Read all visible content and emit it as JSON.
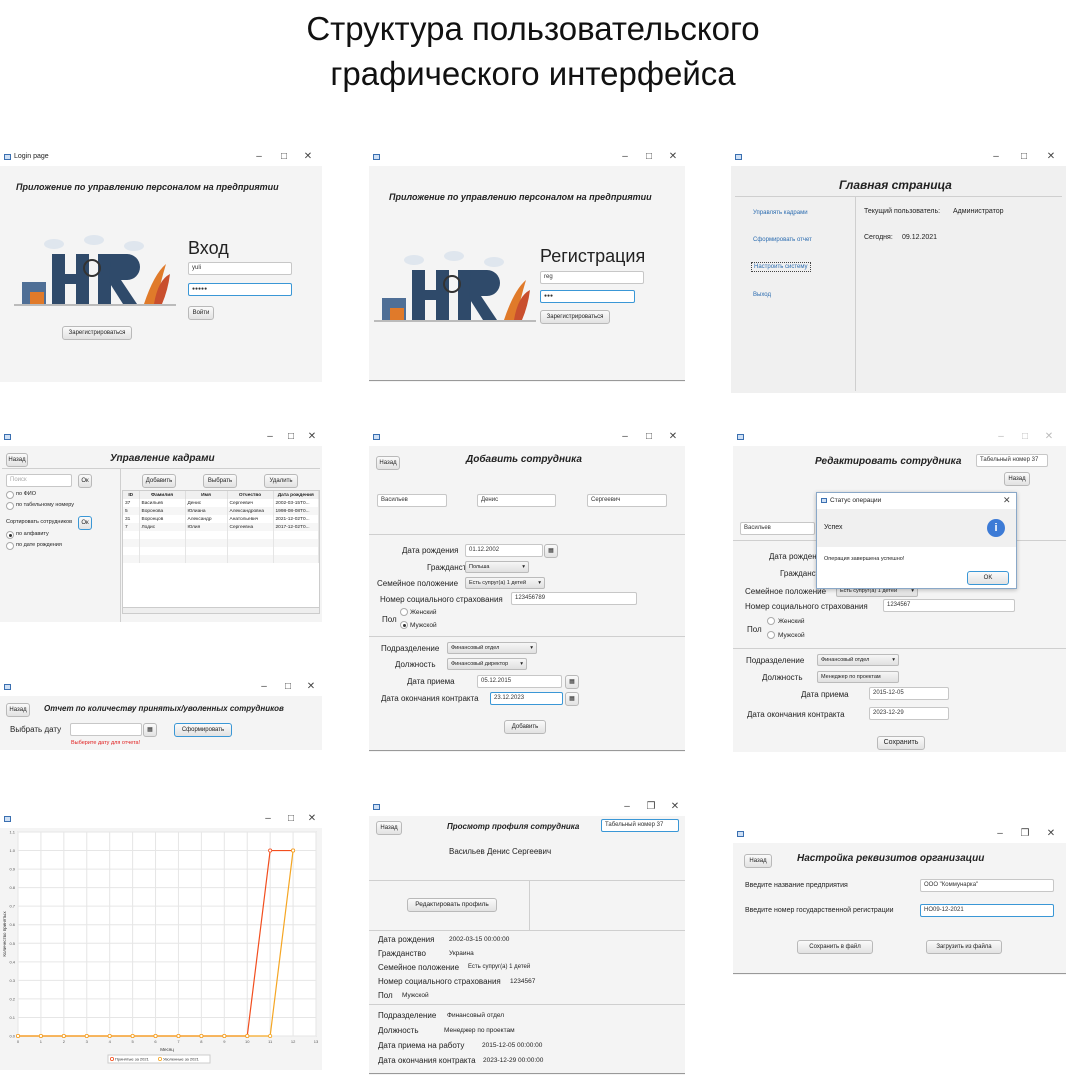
{
  "page_title_line1": "Структура пользовательского",
  "page_title_line2": "графического интерфейса",
  "win_controls": {
    "min": "–",
    "max": "□",
    "close": "✕",
    "restore": "❐"
  },
  "login": {
    "window_title": "Login page",
    "app_title": "Приложение по управлению персоналом на предприятии",
    "heading": "Вход",
    "username_value": "yuli",
    "password_value": "●●●●●",
    "login_button": "Войти",
    "register_button": "Зарегистрироваться"
  },
  "registration": {
    "app_title": "Приложение по управлению персоналом на предприятии",
    "heading": "Регистрация",
    "username_value": "reg",
    "password_value": "●●●",
    "register_button": "Зарегистрироваться"
  },
  "home": {
    "heading": "Главная страница",
    "menu": [
      "Управлять кадрами",
      "Сформировать отчет",
      "Настроить систему",
      "Выход"
    ],
    "current_user_label": "Текущий пользователь:",
    "current_user_value": "Администратор",
    "today_label": "Сегодня:",
    "today_value": "09.12.2021"
  },
  "personnel": {
    "heading": "Управление кадрами",
    "back_button": "Назад",
    "search_placeholder": "Поиск",
    "ok_button": "Ок",
    "search_by": [
      "по ФИО",
      "по табельному номеру"
    ],
    "sort_label": "Сортировать сотрудников",
    "sort_ok": "Ок",
    "sort_by": [
      "по алфавиту",
      "по дате рождения"
    ],
    "add_button": "Добавить",
    "select_button": "Выбрать",
    "delete_button": "Удалить",
    "columns": [
      "ID",
      "Фамилия",
      "Имя",
      "Отчество",
      "Дата рождения"
    ],
    "rows": [
      [
        "37",
        "Васильев",
        "Денис",
        "Сергеевич",
        "2002-03-15T0..."
      ],
      [
        "5",
        "Воронова",
        "Юлиана",
        "Александровна",
        "1998-08-08T0..."
      ],
      [
        "31",
        "Воронцов",
        "Александр",
        "Анатольевич",
        "2021-12-02T0..."
      ],
      [
        "7",
        "Лодис",
        "Юлия",
        "Сергеевна",
        "2017-12-02T0..."
      ]
    ]
  },
  "report": {
    "heading": "Отчет по количеству принятых/уволенных сотрудников",
    "back_button": "Назад",
    "date_label": "Выбрать дату",
    "generate_button": "Сформировать",
    "error_text": "Выберите дату для отчета!"
  },
  "add_employee": {
    "heading": "Добавить сотрудника",
    "back_button": "Назад",
    "last_name": "Васильев",
    "first_name": "Денис",
    "patronymic": "Сергеевич",
    "birth_label": "Дата рождения",
    "birth_value": "01.12.2002",
    "citizenship_label": "Гражданство",
    "citizenship_value": "Польша",
    "marital_label": "Семейное положение",
    "marital_value": "Есть супруг(а) 1 детей",
    "snils_label": "Номер социального страхования",
    "snils_value": "123456789",
    "gender_label": "Пол",
    "gender_options": [
      "Женский",
      "Мужской"
    ],
    "department_label": "Подразделение",
    "department_value": "Финансовый отдел",
    "position_label": "Должность",
    "position_value": "Финансовый директор",
    "hire_label": "Дата приема",
    "hire_value": "05.12.2015",
    "contract_end_label": "Дата окончания контракта",
    "contract_end_value": "23.12.2023",
    "add_button": "Добавить"
  },
  "edit_employee": {
    "heading": "Редактировать сотрудника",
    "tab_number_value": "Табельный номер 37",
    "back_button": "Назад",
    "last_name": "Васильев",
    "birth_label": "Дата рождения",
    "citizenship_label": "Гражданство",
    "marital_label": "Семейное положение",
    "marital_value": "Есть супруг(а) 1 детей",
    "snils_label": "Номер социального страхования",
    "snils_value": "1234567",
    "gender_label": "Пол",
    "gender_options": [
      "Женский",
      "Мужской"
    ],
    "department_label": "Подразделение",
    "department_value": "Финансовый отдел",
    "position_label": "Должность",
    "position_value": "Менеджер по проектам",
    "hire_label": "Дата приема",
    "hire_value": "2015-12-05",
    "contract_end_label": "Дата окончания контракта",
    "contract_end_value": "2023-12-29",
    "save_button": "Сохранить",
    "dialog": {
      "title": "Статус операции",
      "header": "Успех",
      "message": "Операция завершена успешно!",
      "ok_button": "OK"
    }
  },
  "chart_window": {
    "chart_data": {
      "type": "line",
      "x": [
        0,
        1,
        2,
        3,
        4,
        5,
        6,
        7,
        8,
        9,
        10,
        11,
        12
      ],
      "series": [
        {
          "name": "Принятые за 2021",
          "color": "#f24e1e",
          "values": [
            0,
            0,
            0,
            0,
            0,
            0,
            0,
            0,
            0,
            0,
            0,
            1,
            1
          ]
        },
        {
          "name": "Уволенные за 2021",
          "color": "#f5a623",
          "values": [
            0,
            0,
            0,
            0,
            0,
            0,
            0,
            0,
            0,
            0,
            0,
            0,
            1
          ]
        }
      ],
      "xlabel": "Месяц",
      "ylabel": "Количество принятых",
      "xlim": [
        0,
        13
      ],
      "ylim": [
        0,
        1.1
      ],
      "xticks": [
        "0",
        "1",
        "2",
        "3",
        "4",
        "5",
        "6",
        "7",
        "8",
        "9",
        "10",
        "11",
        "12",
        "13"
      ],
      "yticks": [
        "0.0",
        "0.1",
        "0.2",
        "0.3",
        "0.4",
        "0.5",
        "0.6",
        "0.7",
        "0.8",
        "0.9",
        "1.0",
        "1.1"
      ],
      "grid": true,
      "legend": "bottom"
    }
  },
  "profile": {
    "heading": "Просмотр профиля сотрудника",
    "back_button": "Назад",
    "tab_number_value": "Табельный номер 37",
    "full_name": "Васильев Денис Сергеевич",
    "edit_button": "Редактировать профиль",
    "birth_label": "Дата рождения",
    "birth_value": "2002-03-15 00:00:00",
    "citizenship_label": "Гражданство",
    "citizenship_value": "Украина",
    "marital_label": "Семейное положение",
    "marital_value": "Есть супруг(а) 1 детей",
    "snils_label": "Номер социального страхования",
    "snils_value": "1234567",
    "gender_label": "Пол",
    "gender_value": "Мужской",
    "department_label": "Подразделение",
    "department_value": "Финансовый отдел",
    "position_label": "Должность",
    "position_value": "Менеджер по проектам",
    "hire_label": "Дата приема на работу",
    "hire_value": "2015-12-05 00:00:00",
    "contract_end_label": "Дата окончания контракта",
    "contract_end_value": "2023-12-29 00:00:00"
  },
  "org_settings": {
    "heading": "Настройка реквизитов организации",
    "back_button": "Назад",
    "name_label": "Введите название предприятия",
    "name_value": "ООО \"Коммунарка\"",
    "reg_label": "Введите номер государственной регистрации",
    "reg_value": "НО09-12-2021",
    "save_button": "Сохранить в файл",
    "load_button": "Загрузить из файла"
  }
}
